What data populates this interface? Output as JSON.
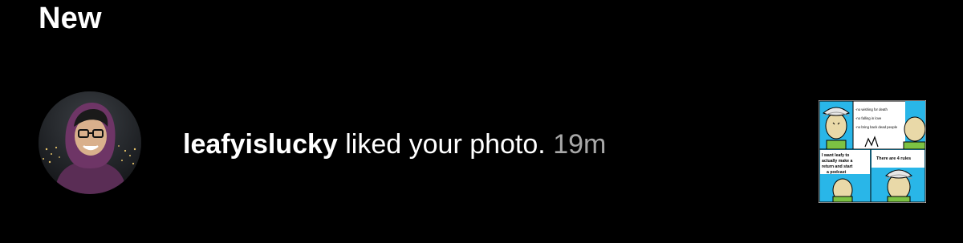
{
  "section": {
    "title": "New"
  },
  "notification": {
    "username": "leafyislucky",
    "action": "liked your photo.",
    "time": "19m",
    "avatar_icon": "user-avatar-photo",
    "thumbnail": {
      "icon": "comic-post-thumbnail",
      "rules": [
        "-no wishing for death",
        "-no falling in love",
        "-no bring back dead people"
      ],
      "panel3_text": [
        "I want leafy to",
        "actually make a",
        "return and start",
        "a podcast"
      ],
      "panel4_text": "There are 4 rules"
    }
  },
  "colors": {
    "background": "#000000",
    "text": "#ffffff",
    "muted": "#a8a8a8",
    "comic_sky": "#29b6e8",
    "comic_green": "#7cc243",
    "comic_skin": "#e9d9a8"
  }
}
